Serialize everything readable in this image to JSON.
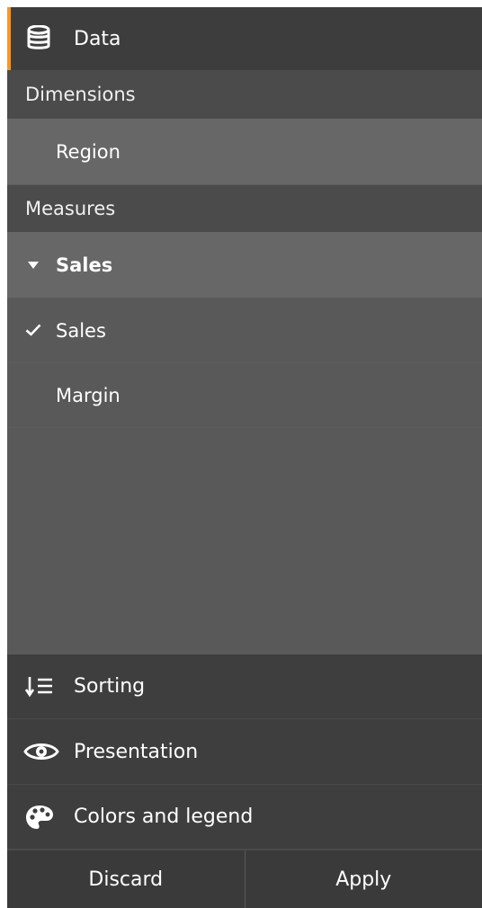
{
  "header": {
    "title": "Data",
    "icon": "database-icon",
    "accent_color": "#f8981d"
  },
  "dimensions": {
    "label": "Dimensions",
    "items": [
      {
        "label": "Region"
      }
    ]
  },
  "measures": {
    "label": "Measures",
    "group": {
      "label": "Sales",
      "icon": "caret-down-icon",
      "expanded": true
    },
    "items": [
      {
        "label": "Sales",
        "checked": true,
        "icon": "checkmark-icon"
      },
      {
        "label": "Margin",
        "checked": false
      }
    ]
  },
  "nav": [
    {
      "label": "Sorting",
      "icon": "sort-icon"
    },
    {
      "label": "Presentation",
      "icon": "eye-icon"
    },
    {
      "label": "Colors and legend",
      "icon": "palette-icon"
    }
  ],
  "footer": {
    "discard_label": "Discard",
    "apply_label": "Apply"
  }
}
